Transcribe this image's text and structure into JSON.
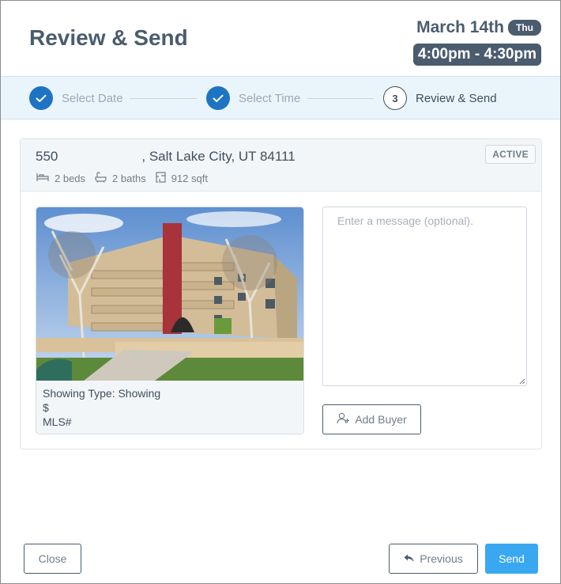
{
  "header": {
    "title": "Review & Send",
    "date": "March 14th",
    "day": "Thu",
    "time_range": "4:00pm - 4:30pm"
  },
  "stepper": {
    "steps": [
      {
        "number": "1",
        "label": "Select Date",
        "state": "done"
      },
      {
        "number": "2",
        "label": "Select Time",
        "state": "done"
      },
      {
        "number": "3",
        "label": "Review & Send",
        "state": "current"
      }
    ]
  },
  "listing": {
    "address_number": "550",
    "address_rest": ", Salt Lake City, UT 84111",
    "status": "ACTIVE",
    "beds": "2 beds",
    "baths": "2 baths",
    "sqft": "912 sqft",
    "showing_type": "Showing Type: Showing",
    "price": "$",
    "mls": "MLS#"
  },
  "message": {
    "placeholder": "Enter a message (optional).",
    "value": ""
  },
  "buttons": {
    "add_buyer": "Add Buyer",
    "close": "Close",
    "previous": "Previous",
    "send": "Send"
  },
  "colors": {
    "accent": "#1e74c2",
    "send": "#3aa8f0",
    "heading": "#4a5c6e",
    "stepper_bg": "#eaf5fb"
  },
  "icons": {
    "step_done": "check-icon",
    "beds": "bed-icon",
    "baths": "bath-icon",
    "sqft": "floorplan-icon",
    "add_buyer": "user-plus-icon",
    "previous": "reply-arrow-icon"
  }
}
